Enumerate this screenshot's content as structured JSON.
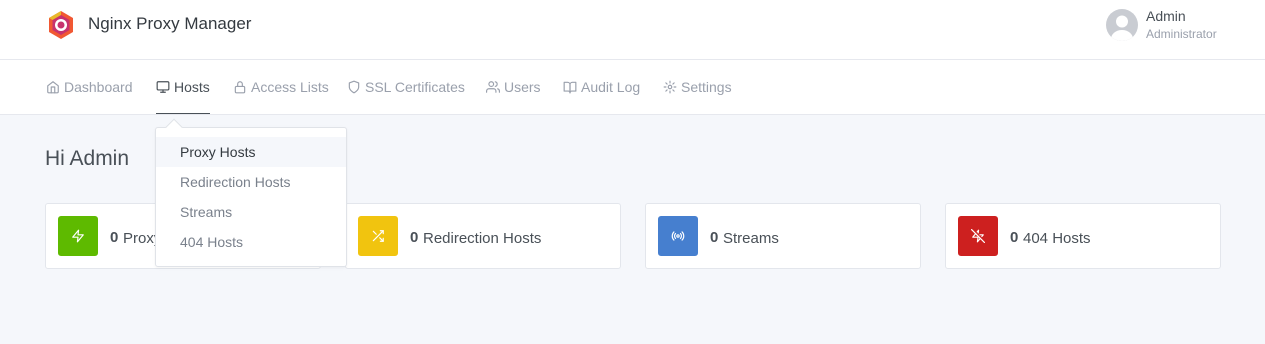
{
  "header": {
    "app_title": "Nginx Proxy Manager",
    "user": {
      "name": "Admin",
      "role": "Administrator"
    },
    "brand_colors": [
      "#f15833",
      "#c7326e",
      "#e8b92a"
    ]
  },
  "nav": {
    "items": [
      {
        "label": "Dashboard",
        "icon": "home-icon",
        "active": false
      },
      {
        "label": "Hosts",
        "icon": "monitor-icon",
        "active": true
      },
      {
        "label": "Access Lists",
        "icon": "lock-icon",
        "active": false
      },
      {
        "label": "SSL Certificates",
        "icon": "shield-icon",
        "active": false
      },
      {
        "label": "Users",
        "icon": "users-icon",
        "active": false
      },
      {
        "label": "Audit Log",
        "icon": "book-icon",
        "active": false
      },
      {
        "label": "Settings",
        "icon": "gear-icon",
        "active": false
      }
    ]
  },
  "dropdown": {
    "items": [
      {
        "label": "Proxy Hosts",
        "highlighted": true
      },
      {
        "label": "Redirection Hosts",
        "highlighted": false
      },
      {
        "label": "Streams",
        "highlighted": false
      },
      {
        "label": "404 Hosts",
        "highlighted": false
      }
    ]
  },
  "main": {
    "greeting": "Hi Admin",
    "cards": [
      {
        "count": "0",
        "label": "Proxy Hosts",
        "icon": "zap-icon",
        "color": "#5eba00"
      },
      {
        "count": "0",
        "label": "Redirection Hosts",
        "icon": "shuffle-icon",
        "color": "#f1c40f"
      },
      {
        "count": "0",
        "label": "Streams",
        "icon": "radio-icon",
        "color": "#467fcf"
      },
      {
        "count": "0",
        "label": "404 Hosts",
        "icon": "zap-off-icon",
        "color": "#cd201f"
      }
    ]
  }
}
